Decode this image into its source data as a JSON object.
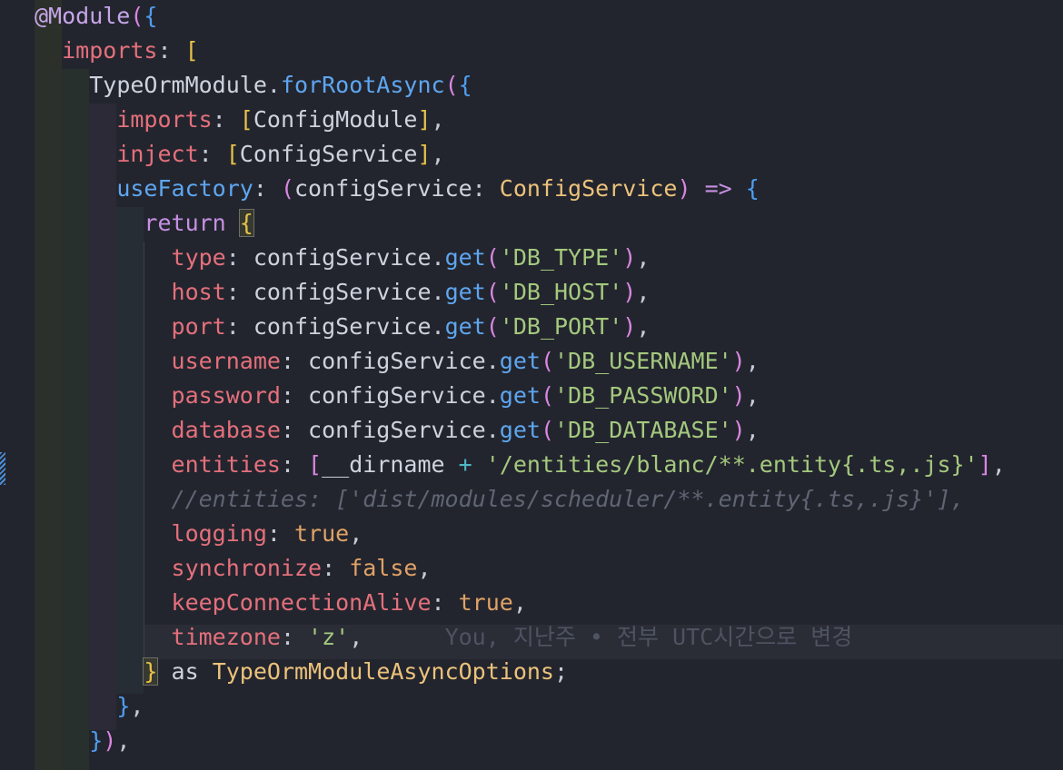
{
  "code": {
    "lines": [
      {
        "indent": "",
        "tokens": [
          {
            "t": "@Module",
            "c": "t-dec"
          },
          {
            "t": "(",
            "c": "t-brk1"
          },
          {
            "t": "{",
            "c": "t-brk2"
          }
        ]
      },
      {
        "indent": "  ",
        "tokens": [
          {
            "t": "imports",
            "c": "t-key"
          },
          {
            "t": ": ",
            "c": "t-pun"
          },
          {
            "t": "[",
            "c": "t-brk3"
          }
        ]
      },
      {
        "indent": "    ",
        "tokens": [
          {
            "t": "TypeOrmModule",
            "c": "t-plain"
          },
          {
            "t": ".",
            "c": "t-pun"
          },
          {
            "t": "forRootAsync",
            "c": "t-fn"
          },
          {
            "t": "(",
            "c": "t-brk1"
          },
          {
            "t": "{",
            "c": "t-brk2"
          }
        ]
      },
      {
        "indent": "      ",
        "tokens": [
          {
            "t": "imports",
            "c": "t-key"
          },
          {
            "t": ": ",
            "c": "t-pun"
          },
          {
            "t": "[",
            "c": "t-brk3"
          },
          {
            "t": "ConfigModule",
            "c": "t-plain"
          },
          {
            "t": "]",
            "c": "t-brk3"
          },
          {
            "t": ",",
            "c": "t-pun"
          }
        ]
      },
      {
        "indent": "      ",
        "tokens": [
          {
            "t": "inject",
            "c": "t-key"
          },
          {
            "t": ": ",
            "c": "t-pun"
          },
          {
            "t": "[",
            "c": "t-brk3"
          },
          {
            "t": "ConfigService",
            "c": "t-plain"
          },
          {
            "t": "]",
            "c": "t-brk3"
          },
          {
            "t": ",",
            "c": "t-pun"
          }
        ]
      },
      {
        "indent": "      ",
        "tokens": [
          {
            "t": "useFactory",
            "c": "t-fn"
          },
          {
            "t": ": ",
            "c": "t-pun"
          },
          {
            "t": "(",
            "c": "t-brk1"
          },
          {
            "t": "configService",
            "c": "t-plain"
          },
          {
            "t": ": ",
            "c": "t-pun"
          },
          {
            "t": "ConfigService",
            "c": "t-type"
          },
          {
            "t": ")",
            "c": "t-brk1"
          },
          {
            "t": " ",
            "c": "t-pun"
          },
          {
            "t": "=>",
            "c": "t-ret"
          },
          {
            "t": " ",
            "c": "t-pun"
          },
          {
            "t": "{",
            "c": "t-brk2"
          }
        ]
      },
      {
        "indent": "        ",
        "tokens": [
          {
            "t": "return",
            "c": "t-ret"
          },
          {
            "t": " ",
            "c": "t-pun"
          },
          {
            "t": "{",
            "c": "t-brk3 brace-hl"
          }
        ]
      },
      {
        "indent": "          ",
        "tokens": [
          {
            "t": "type",
            "c": "t-key"
          },
          {
            "t": ": ",
            "c": "t-pun"
          },
          {
            "t": "configService",
            "c": "t-plain"
          },
          {
            "t": ".",
            "c": "t-pun"
          },
          {
            "t": "get",
            "c": "t-fn"
          },
          {
            "t": "(",
            "c": "t-brk1"
          },
          {
            "t": "'DB_TYPE'",
            "c": "t-str"
          },
          {
            "t": ")",
            "c": "t-brk1"
          },
          {
            "t": ",",
            "c": "t-pun"
          }
        ]
      },
      {
        "indent": "          ",
        "tokens": [
          {
            "t": "host",
            "c": "t-key"
          },
          {
            "t": ": ",
            "c": "t-pun"
          },
          {
            "t": "configService",
            "c": "t-plain"
          },
          {
            "t": ".",
            "c": "t-pun"
          },
          {
            "t": "get",
            "c": "t-fn"
          },
          {
            "t": "(",
            "c": "t-brk1"
          },
          {
            "t": "'DB_HOST'",
            "c": "t-str"
          },
          {
            "t": ")",
            "c": "t-brk1"
          },
          {
            "t": ",",
            "c": "t-pun"
          }
        ]
      },
      {
        "indent": "          ",
        "tokens": [
          {
            "t": "port",
            "c": "t-key"
          },
          {
            "t": ": ",
            "c": "t-pun"
          },
          {
            "t": "configService",
            "c": "t-plain"
          },
          {
            "t": ".",
            "c": "t-pun"
          },
          {
            "t": "get",
            "c": "t-fn"
          },
          {
            "t": "(",
            "c": "t-brk1"
          },
          {
            "t": "'DB_PORT'",
            "c": "t-str"
          },
          {
            "t": ")",
            "c": "t-brk1"
          },
          {
            "t": ",",
            "c": "t-pun"
          }
        ]
      },
      {
        "indent": "          ",
        "tokens": [
          {
            "t": "username",
            "c": "t-key"
          },
          {
            "t": ": ",
            "c": "t-pun"
          },
          {
            "t": "configService",
            "c": "t-plain"
          },
          {
            "t": ".",
            "c": "t-pun"
          },
          {
            "t": "get",
            "c": "t-fn"
          },
          {
            "t": "(",
            "c": "t-brk1"
          },
          {
            "t": "'DB_USERNAME'",
            "c": "t-str"
          },
          {
            "t": ")",
            "c": "t-brk1"
          },
          {
            "t": ",",
            "c": "t-pun"
          }
        ]
      },
      {
        "indent": "          ",
        "tokens": [
          {
            "t": "password",
            "c": "t-key"
          },
          {
            "t": ": ",
            "c": "t-pun"
          },
          {
            "t": "configService",
            "c": "t-plain"
          },
          {
            "t": ".",
            "c": "t-pun"
          },
          {
            "t": "get",
            "c": "t-fn"
          },
          {
            "t": "(",
            "c": "t-brk1"
          },
          {
            "t": "'DB_PASSWORD'",
            "c": "t-str"
          },
          {
            "t": ")",
            "c": "t-brk1"
          },
          {
            "t": ",",
            "c": "t-pun"
          }
        ]
      },
      {
        "indent": "          ",
        "tokens": [
          {
            "t": "database",
            "c": "t-key"
          },
          {
            "t": ": ",
            "c": "t-pun"
          },
          {
            "t": "configService",
            "c": "t-plain"
          },
          {
            "t": ".",
            "c": "t-pun"
          },
          {
            "t": "get",
            "c": "t-fn"
          },
          {
            "t": "(",
            "c": "t-brk1"
          },
          {
            "t": "'DB_DATABASE'",
            "c": "t-str"
          },
          {
            "t": ")",
            "c": "t-brk1"
          },
          {
            "t": ",",
            "c": "t-pun"
          }
        ]
      },
      {
        "indent": "          ",
        "tokens": [
          {
            "t": "entities",
            "c": "t-key"
          },
          {
            "t": ": ",
            "c": "t-pun"
          },
          {
            "t": "[",
            "c": "t-brk1"
          },
          {
            "t": "__dirname",
            "c": "t-plain"
          },
          {
            "t": " ",
            "c": "t-pun"
          },
          {
            "t": "+",
            "c": "t-op"
          },
          {
            "t": " ",
            "c": "t-pun"
          },
          {
            "t": "'/entities/blanc/**.entity{.ts,.js}'",
            "c": "t-str"
          },
          {
            "t": "]",
            "c": "t-brk1"
          },
          {
            "t": ",",
            "c": "t-pun"
          }
        ]
      },
      {
        "indent": "          ",
        "tokens": [
          {
            "t": "//entities: ['dist/modules/scheduler/**.entity{.ts,.js}'],",
            "c": "t-cmt"
          }
        ]
      },
      {
        "indent": "          ",
        "tokens": [
          {
            "t": "logging",
            "c": "t-key"
          },
          {
            "t": ": ",
            "c": "t-pun"
          },
          {
            "t": "true",
            "c": "t-bool"
          },
          {
            "t": ",",
            "c": "t-pun"
          }
        ]
      },
      {
        "indent": "          ",
        "tokens": [
          {
            "t": "synchronize",
            "c": "t-key"
          },
          {
            "t": ": ",
            "c": "t-pun"
          },
          {
            "t": "false",
            "c": "t-bool"
          },
          {
            "t": ",",
            "c": "t-pun"
          }
        ]
      },
      {
        "indent": "          ",
        "tokens": [
          {
            "t": "keepConnectionAlive",
            "c": "t-key"
          },
          {
            "t": ": ",
            "c": "t-pun"
          },
          {
            "t": "true",
            "c": "t-bool"
          },
          {
            "t": ",",
            "c": "t-pun"
          }
        ]
      },
      {
        "indent": "          ",
        "tokens": [
          {
            "t": "timezone",
            "c": "t-key"
          },
          {
            "t": ": ",
            "c": "t-pun"
          },
          {
            "t": "'z'",
            "c": "t-str"
          },
          {
            "t": ",",
            "c": "t-pun"
          },
          {
            "t": "      You, 지난주 • 전부 UTC시간으로 변경",
            "c": "t-blame"
          }
        ]
      },
      {
        "indent": "        ",
        "tokens": [
          {
            "t": "}",
            "c": "t-brk3 brace-hl"
          },
          {
            "t": " as ",
            "c": "t-plain"
          },
          {
            "t": "TypeOrmModuleAsyncOptions",
            "c": "t-type"
          },
          {
            "t": ";",
            "c": "t-pun"
          }
        ]
      },
      {
        "indent": "      ",
        "tokens": [
          {
            "t": "}",
            "c": "t-brk2"
          },
          {
            "t": ",",
            "c": "t-pun"
          }
        ]
      },
      {
        "indent": "    ",
        "tokens": [
          {
            "t": "}",
            "c": "t-brk2"
          },
          {
            "t": ")",
            "c": "t-brk1"
          },
          {
            "t": ",",
            "c": "t-pun"
          }
        ]
      }
    ]
  }
}
